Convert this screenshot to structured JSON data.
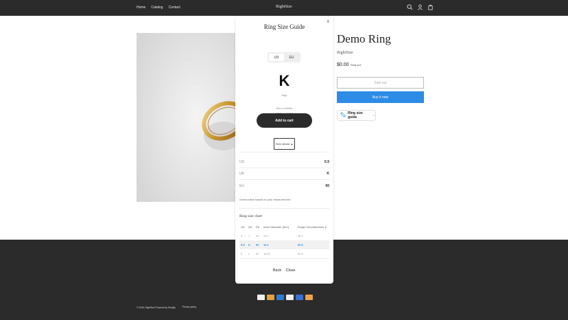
{
  "header": {
    "nav": [
      "Home",
      "Catalog",
      "Contact"
    ],
    "brand": "RightSize",
    "icons": [
      "search-icon",
      "account-icon",
      "cart-icon"
    ]
  },
  "product": {
    "title": "Demo Ring",
    "vendor": "RightSize",
    "price": "$0.00",
    "sold_badge": "Sold out",
    "sold_out_label": "Sold out",
    "buy_label": "Buy it now",
    "guide_label": "Ring size guide",
    "guide_arrow": "→"
  },
  "modal": {
    "close": "X",
    "title": "Ring Size Guide",
    "toggle": [
      "US",
      "EU"
    ],
    "size": "K",
    "size_sub": "High",
    "also_label": "Also consider",
    "alternatives": [
      "J",
      "L"
    ],
    "add_to_cart": "Add to cart",
    "hide_details": "Hide details",
    "hide_icon": "▲",
    "details": [
      {
        "key": "US",
        "value": "5.5"
      },
      {
        "key": "UK",
        "value": "K"
      },
      {
        "key": "EU",
        "value": "50"
      }
    ],
    "match_text": "Great match based on your measurement.",
    "chart_title": "Ring size chart",
    "chart_headers": [
      "US",
      "UK",
      "EU",
      "Inner Diameter (mm)",
      "Finger Circumference (r"
    ],
    "chart_rows": [
      [
        "5",
        "J",
        "49",
        "15.7",
        "49.3"
      ],
      [
        "5.5",
        "K",
        "50",
        "16.1",
        "50.5"
      ],
      [
        "6",
        "L",
        "52",
        "16.51",
        "51.8"
      ]
    ],
    "back_label": "Back",
    "close_label": "Close"
  },
  "footer": {
    "copyright": "© 2026, RightSize Powered by Shopify",
    "privacy": "Privacy policy",
    "payments": [
      "visa-icon",
      "mastercard-icon",
      "amex-icon",
      "paypal-icon",
      "diners-icon",
      "discover-icon"
    ]
  },
  "colors": {
    "accent": "#2c8ce6",
    "dark": "#2b2b2b"
  }
}
